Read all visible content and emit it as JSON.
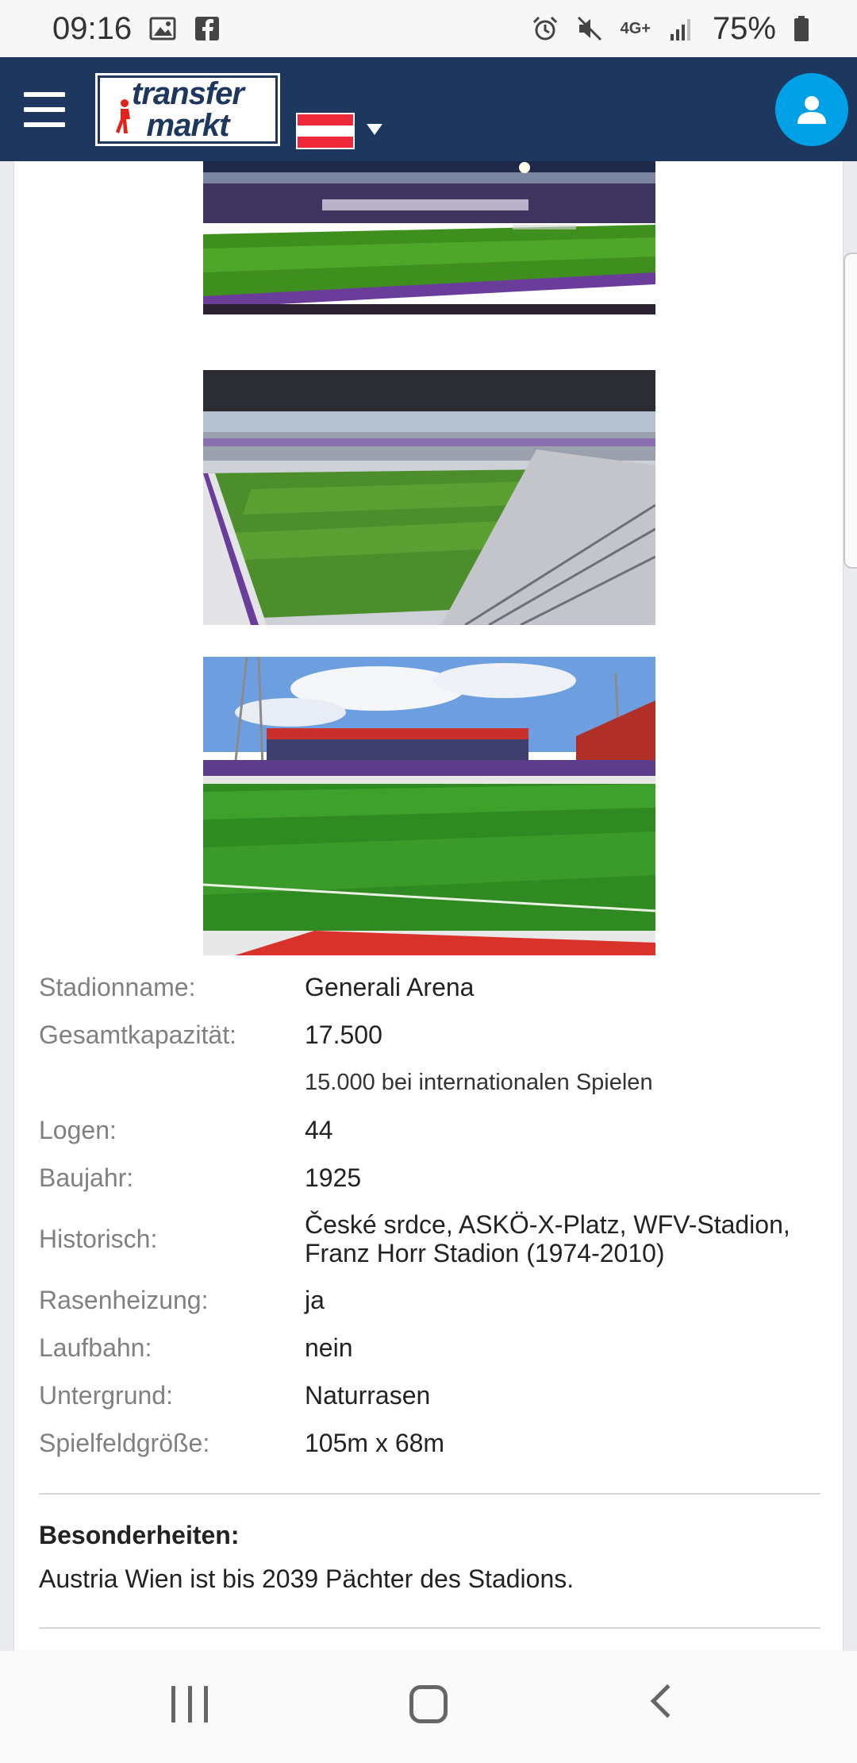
{
  "status_bar": {
    "time": "09:16",
    "network": "4G+",
    "battery": "75%"
  },
  "app_bar": {
    "logo_line1": "transfer",
    "logo_line2": "markt",
    "flag_country": "Austria"
  },
  "colors": {
    "nav_bg": "#1d375e",
    "accent_blue": "#00a0e6",
    "flag_red": "#ed2939",
    "label_gray": "#808080"
  },
  "stadium_info": {
    "rows": [
      {
        "label": "Stadionname:",
        "value": "Generali Arena"
      },
      {
        "label": "Gesamtkapazität:",
        "value": "17.500"
      },
      {
        "label": "",
        "value": "15.000 bei internationalen Spielen"
      },
      {
        "label": "Logen:",
        "value": "44"
      },
      {
        "label": "Baujahr:",
        "value": "1925"
      },
      {
        "label": "Historisch:",
        "value": "České srdce, ASKÖ-X-Platz, WFV-Stadion,",
        "value2": "Franz Horr Stadion (1974-2010)"
      },
      {
        "label": "Rasenheizung:",
        "value": "ja"
      },
      {
        "label": "Laufbahn:",
        "value": "nein"
      },
      {
        "label": "Untergrund:",
        "value": "Naturrasen"
      },
      {
        "label": "Spielfeldgröße:",
        "value": "105m x 68m"
      }
    ]
  },
  "notes": {
    "title": "Besonderheiten:",
    "text": "Austria Wien ist bis 2039 Pächter des Stadions."
  }
}
